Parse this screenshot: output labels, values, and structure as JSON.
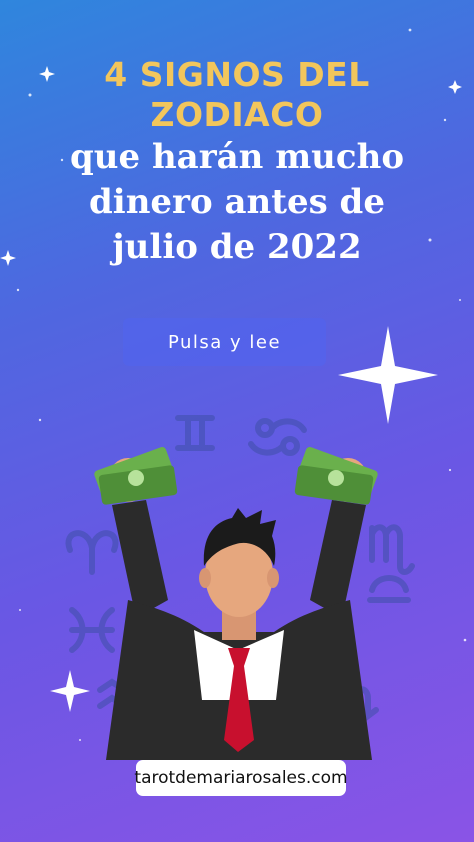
{
  "headline": {
    "line1": "4 SIGNOS DEL",
    "line2": "ZODIACO",
    "line3": "que harán mucho",
    "line4": "dinero antes de",
    "line5": "julio de 2022"
  },
  "cta": {
    "label": "Pulsa y lee"
  },
  "footer": {
    "url": "tarotdemariarosales.com"
  },
  "colors": {
    "gold": "#f2c65c",
    "suit": "#2b2b2b",
    "tie": "#c8102e",
    "skin": "#e6a77e",
    "money": "#6ab04c"
  }
}
